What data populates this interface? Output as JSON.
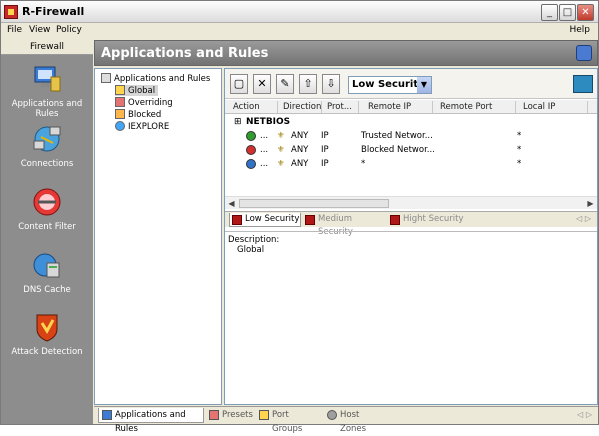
{
  "window": {
    "title": "R-Firewall",
    "min": "_",
    "max": "□",
    "close": "✕"
  },
  "menu": {
    "file": "File",
    "view": "View",
    "policy": "Policy",
    "help": "Help"
  },
  "left_panel": {
    "title": "Firewall",
    "items": [
      {
        "label": "Applications and Rules",
        "icon": "computer-icon"
      },
      {
        "label": "Connections",
        "icon": "network-icon"
      },
      {
        "label": "Content Filter",
        "icon": "filter-icon"
      },
      {
        "label": "DNS Cache",
        "icon": "dns-icon"
      },
      {
        "label": "Attack Detection",
        "icon": "shield-icon"
      }
    ]
  },
  "header": {
    "title": "Applications and Rules"
  },
  "tree": {
    "root": "Applications and Rules",
    "children": [
      "Global",
      "Overriding",
      "Blocked",
      "IEXPLORE"
    ]
  },
  "toolbar": {
    "security_level": "Low Security"
  },
  "grid": {
    "columns": [
      "Action",
      "Direction",
      "Prot...",
      "Remote IP",
      "Remote Port",
      "Local IP"
    ],
    "group": "NETBIOS",
    "rows": [
      {
        "action": "allow",
        "dots": "...",
        "direction": "ANY",
        "protocol": "IP",
        "remote_ip": "Trusted Networ...",
        "remote_port": "",
        "local_ip": "*"
      },
      {
        "action": "block",
        "dots": "...",
        "direction": "ANY",
        "protocol": "IP",
        "remote_ip": "Blocked Networ...",
        "remote_port": "",
        "local_ip": "*"
      },
      {
        "action": "ask",
        "dots": "...",
        "direction": "ANY",
        "protocol": "IP",
        "remote_ip": "*",
        "remote_port": "",
        "local_ip": "*"
      }
    ],
    "colors": {
      "allow": "#2e9d2e",
      "block": "#d32f2f",
      "ask": "#2f73c9"
    }
  },
  "security_tabs": [
    "Low Security",
    "Medium Security",
    "Hight Security"
  ],
  "description": {
    "label": "Description:",
    "value": "Global"
  },
  "bottom_tabs": [
    "Applications and Rules",
    "Presets",
    "Port Groups",
    "Host Zones"
  ],
  "nav_arrows": "◁ ▷"
}
